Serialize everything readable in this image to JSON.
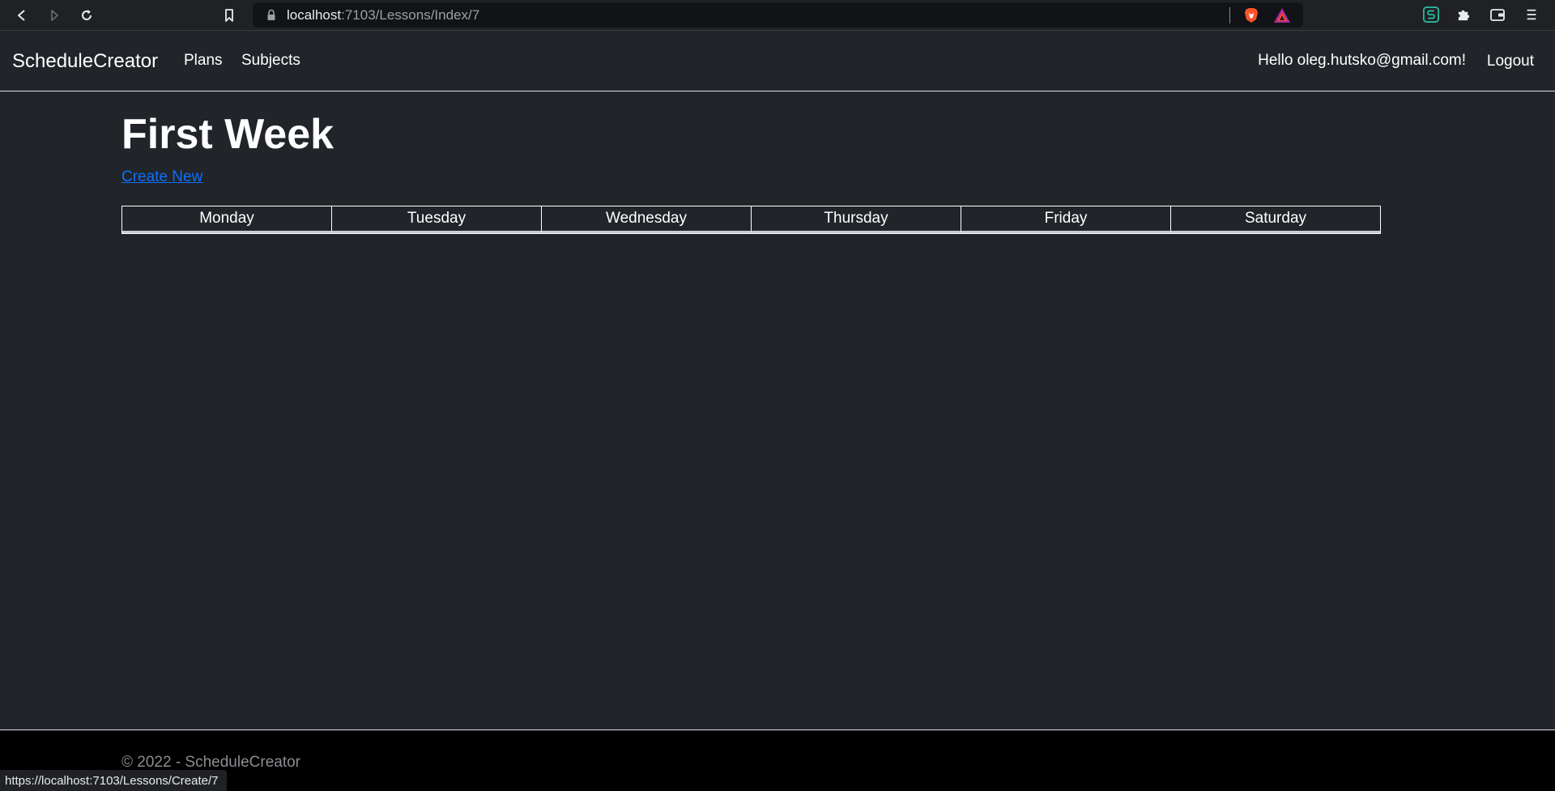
{
  "browser": {
    "url_host": "localhost",
    "url_path": ":7103/Lessons/Index/7",
    "status_url": "https://localhost:7103/Lessons/Create/7"
  },
  "navbar": {
    "brand": "ScheduleCreator",
    "links": [
      {
        "label": "Plans"
      },
      {
        "label": "Subjects"
      }
    ],
    "greeting": "Hello oleg.hutsko@gmail.com!",
    "logout_label": "Logout"
  },
  "main": {
    "title": "First Week",
    "create_link": "Create New",
    "days": [
      "Monday",
      "Tuesday",
      "Wednesday",
      "Thursday",
      "Friday",
      "Saturday"
    ]
  },
  "footer": {
    "text": "© 2022 - ScheduleCreator"
  },
  "colors": {
    "page_bg": "#212529",
    "footer_bg": "#000000",
    "link": "#0d6efd",
    "text": "#ffffff"
  },
  "icons": {
    "back": "back-icon",
    "forward": "forward-icon",
    "reload": "reload-icon",
    "bookmark": "bookmark-icon",
    "lock": "lock-icon",
    "brave_shields": "brave-shields-icon",
    "brave_rewards": "brave-rewards-icon",
    "extension_s": "extension-s-icon",
    "extensions": "puzzle-icon",
    "wallet": "wallet-icon",
    "menu": "menu-icon"
  }
}
